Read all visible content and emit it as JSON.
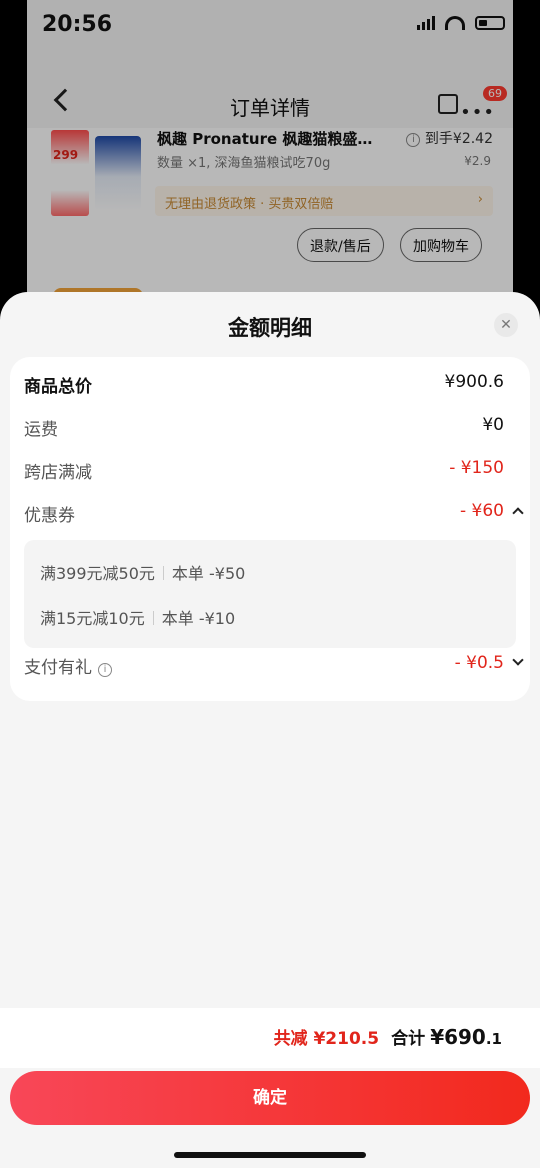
{
  "status_bar": {
    "time": "20:56"
  },
  "background_page": {
    "title": "订单详情",
    "badge_count": "69",
    "product": {
      "name": "枫趣 Pronature 枫趣猫粮盛…",
      "price_label": "到手¥2.42",
      "original_price": "¥2.9",
      "spec": "数量 ×1, 深海鱼猫粮试吃70g",
      "promo_price": "299",
      "policy": "无理由退货政策 · 买贵双倍赔",
      "refund_button": "退款/售后",
      "cart_button": "加购物车"
    }
  },
  "sheet": {
    "title": "金额明细",
    "rows": [
      {
        "label": "商品总价",
        "value": "¥900.6"
      },
      {
        "label": "运费",
        "value": "¥0"
      },
      {
        "label": "跨店满减",
        "value": "- ¥150"
      },
      {
        "label": "优惠券",
        "value": "- ¥60"
      },
      {
        "label": "支付有礼",
        "value": "- ¥0.5"
      }
    ],
    "coupons": [
      {
        "name": "满399元减50元",
        "amount": "本单 -¥50"
      },
      {
        "name": "满15元减10元",
        "amount": "本单 -¥10"
      }
    ],
    "footer": {
      "saved": "共减 ¥210.5",
      "total_label": "合计",
      "total_currency_int": "¥690",
      "total_decimal": ".1"
    },
    "confirm_button": "确定"
  },
  "colors": {
    "accent_red": "#e1251b",
    "button_gradient_start": "#f84758",
    "button_gradient_end": "#f2291d"
  }
}
